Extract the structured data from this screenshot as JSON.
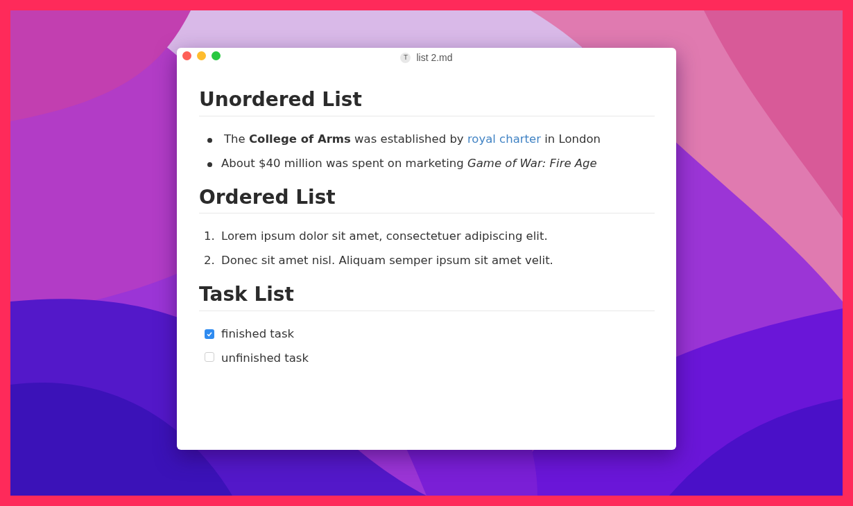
{
  "window": {
    "title": "list 2.md",
    "file_icon_letter": "T"
  },
  "sections": [
    {
      "heading": "Unordered List",
      "kind": "bullets",
      "items": [
        {
          "parts": [
            {
              "kind": "text",
              "text": "The **College of Arms** was established by "
            },
            {
              "kind": "link",
              "text": "royal charter"
            },
            {
              "kind": "text",
              "text": " in London"
            }
          ]
        },
        {
          "parts": [
            {
              "kind": "text",
              "text": "About $40 million was spent on marketing *Game of War: Fire Age*"
            }
          ]
        }
      ]
    },
    {
      "heading": "Ordered List",
      "kind": "numbers",
      "items": [
        {
          "number": "1.",
          "parts": [
            {
              "kind": "text",
              "text": "Lorem ipsum dolor sit amet, consectetuer adipiscing elit."
            }
          ]
        },
        {
          "number": "2.",
          "parts": [
            {
              "kind": "text",
              "text": "Donec sit amet nisl. Aliquam semper ipsum sit amet velit."
            }
          ]
        }
      ]
    },
    {
      "heading": "Task List",
      "kind": "tasks",
      "items": [
        {
          "checked": true,
          "parts": [
            {
              "kind": "text",
              "text": "finished task"
            }
          ]
        },
        {
          "checked": false,
          "parts": [
            {
              "kind": "text",
              "text": "unfinished task"
            }
          ]
        }
      ]
    }
  ]
}
